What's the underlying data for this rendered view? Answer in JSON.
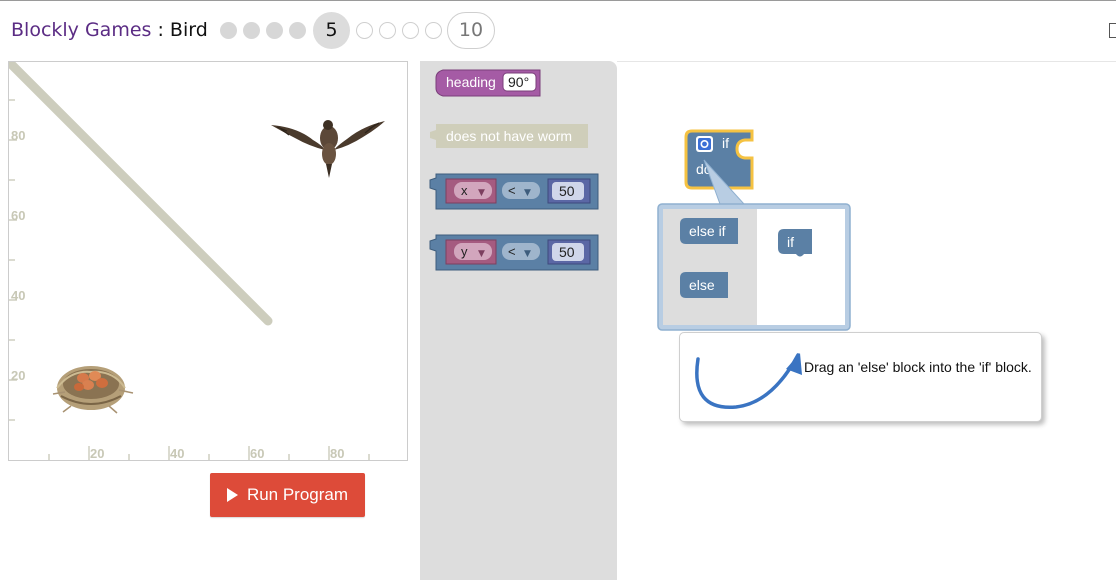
{
  "header": {
    "app_name": "Blockly Games",
    "separator": " : ",
    "game_name": "Bird",
    "current_level": "5",
    "max_level": "10"
  },
  "visualization": {
    "y_ticks": [
      "80",
      "60",
      "40",
      "20"
    ],
    "x_ticks": [
      "20",
      "40",
      "60",
      "80"
    ]
  },
  "run_button": {
    "label": "Run Program"
  },
  "toolbox": {
    "heading_label": "heading",
    "heading_value": "90°",
    "worm_label": "does not have worm",
    "compare_x": {
      "var": "x",
      "op": "<",
      "value": "50"
    },
    "compare_y": {
      "var": "y",
      "op": "<",
      "value": "50"
    }
  },
  "workspace": {
    "if_label": "if",
    "do_label": "do",
    "mutator": {
      "else_if_label": "else if",
      "else_label": "else",
      "if_label": "if"
    }
  },
  "hint": {
    "text": "Drag an 'else' block into the 'if' block."
  },
  "colors": {
    "brand": "#5b2c84",
    "run_button": "#dd4b39",
    "logic_block": "#5b80a5",
    "heading_block": "#a55ba5",
    "variable_block": "#a55b80",
    "disabled_block": "#cfceba"
  }
}
